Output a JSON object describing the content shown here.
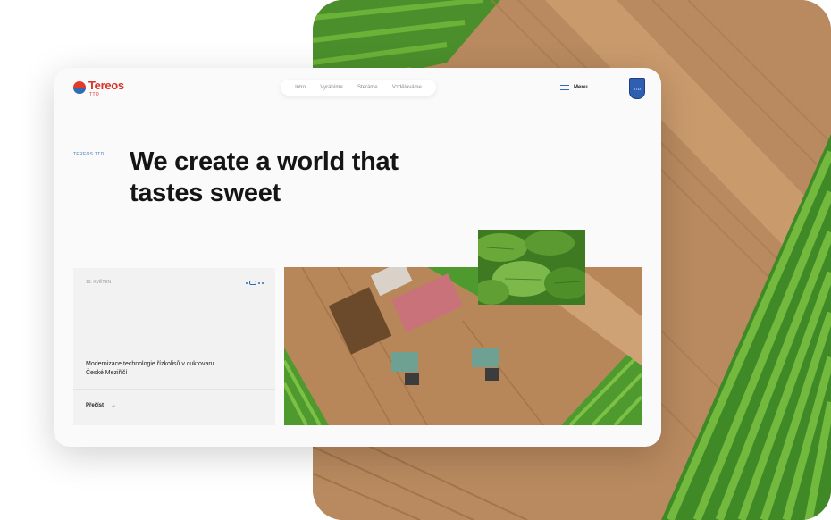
{
  "brand": {
    "name": "Tereos",
    "sub": "TTD"
  },
  "nav": {
    "items": [
      "Intro",
      "Vyrábíme",
      "Steráme",
      "Vzděláváme"
    ]
  },
  "menu": {
    "label": "Menu"
  },
  "badge": {
    "text": "TTD"
  },
  "hero": {
    "eyebrow": "TEREOS TTD",
    "headline": "We create a world that tastes sweet"
  },
  "news": {
    "date": "19. KVĚTEN",
    "title": "Modernizace technologie řízkolisů v cukrovaru České Meziříčí",
    "link_label": "Přečíst",
    "link_arrow": "→"
  },
  "colors": {
    "brand_red": "#d8332a",
    "accent_blue": "#2f6db3",
    "field_soil": "#b98a5f",
    "crop_green": "#4f9a2f"
  }
}
